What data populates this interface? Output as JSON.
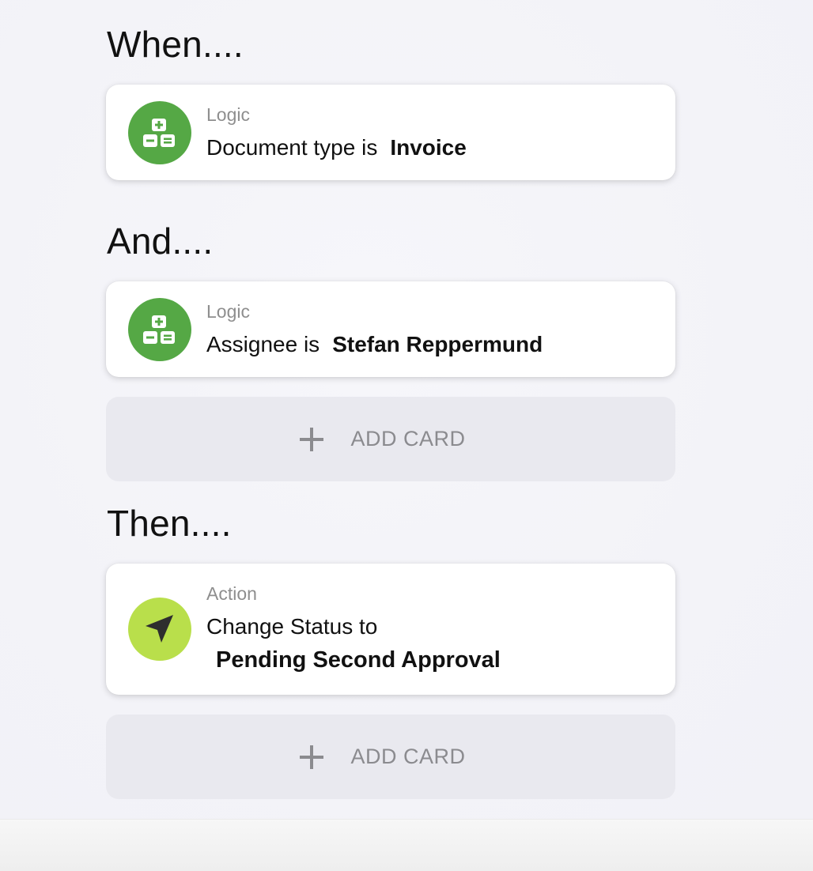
{
  "sections": {
    "when": {
      "heading": "When...."
    },
    "and": {
      "heading": "And...."
    },
    "then": {
      "heading": "Then...."
    }
  },
  "cards": [
    {
      "kind": "Logic",
      "text": "Document type is",
      "value": "Invoice",
      "icon": "logic-blocks-icon",
      "icon_color": "#55a845"
    },
    {
      "kind": "Logic",
      "text": "Assignee is",
      "value": "Stefan Reppermund",
      "icon": "logic-blocks-icon",
      "icon_color": "#55a845"
    },
    {
      "kind": "Action",
      "text": "Change Status to",
      "value": "Pending Second Approval",
      "icon": "navigation-arrow-icon",
      "icon_color": "#b9df4b"
    }
  ],
  "add_buttons": [
    {
      "label": "ADD CARD",
      "icon": "plus-icon"
    },
    {
      "label": "ADD CARD",
      "icon": "plus-icon"
    }
  ],
  "colors": {
    "background": "#f3f3f8",
    "card": "#ffffff",
    "add_card_bg": "#e9e9ef",
    "muted_text": "#8e8e8e"
  }
}
